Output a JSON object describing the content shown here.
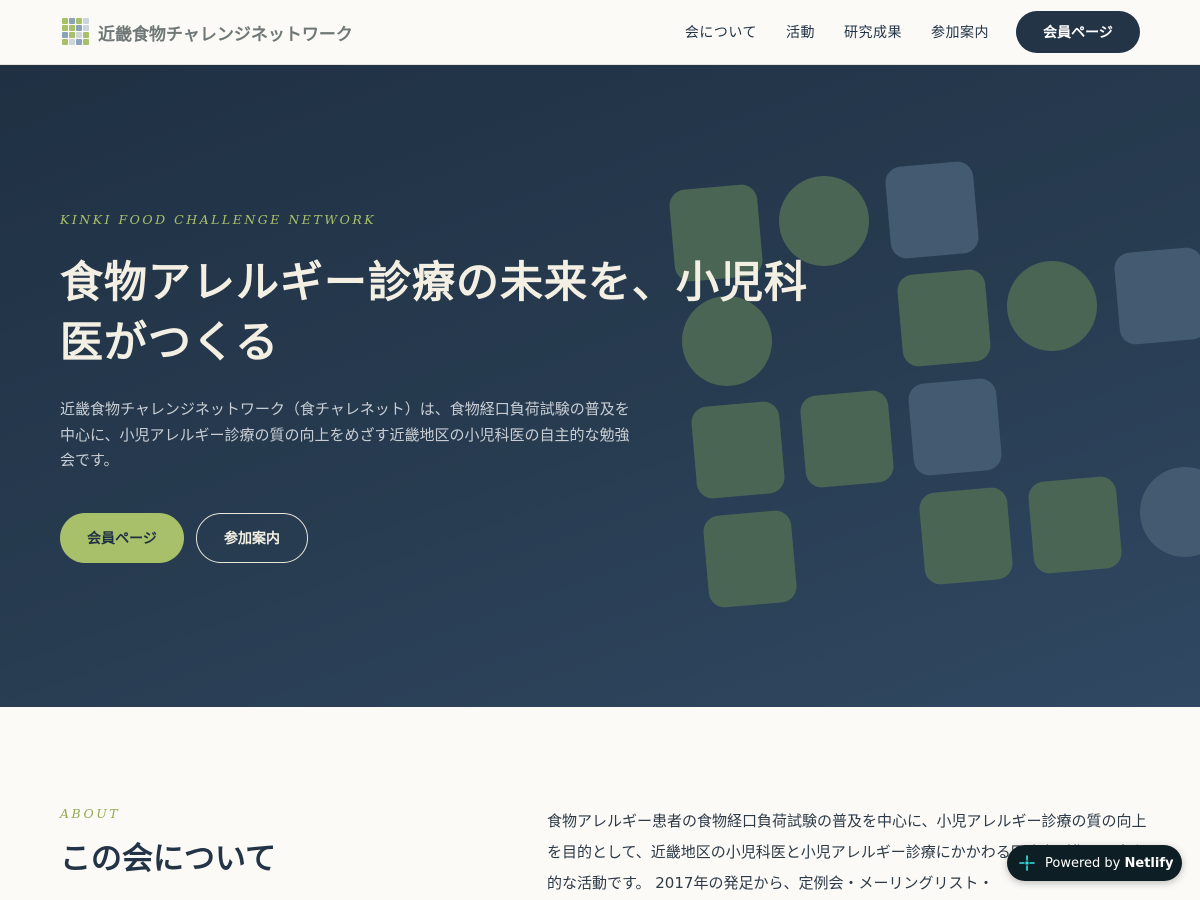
{
  "header": {
    "logo_text": "近畿食物チャレンジネットワーク",
    "nav": [
      {
        "label": "会について"
      },
      {
        "label": "活動"
      },
      {
        "label": "研究成果"
      },
      {
        "label": "参加案内"
      }
    ],
    "member_button": "会員ページ"
  },
  "hero": {
    "eyebrow": "KINKI FOOD CHALLENGE NETWORK",
    "title": "食物アレルギー診療の未来を、小児科医がつくる",
    "description": "近畿食物チャレンジネットワーク（食チャレネット）は、食物経口負荷試験の普及を中心に、小児アレルギー診療の質の向上をめざす近畿地区の小児科医の自主的な勉強会です。",
    "primary_button": "会員ページ",
    "secondary_button": "参加案内"
  },
  "about": {
    "label": "ABOUT",
    "title": "この会について",
    "text": "食物アレルギー患者の食物経口負荷試験の普及を中心に、小児アレルギー診療の質の向上を目的として、近畿地区の小児科医と小児アレルギー診療にかかわる医療者が集まる自主的な活動です。 2017年の発足から、定例会・メーリングリスト・"
  },
  "badge": {
    "prefix": "Powered by",
    "brand": "Netlify",
    "icon": "netlify-icon"
  },
  "colors": {
    "navy": "#233447",
    "accent_green": "#a9c06a",
    "cream": "#fbfaf6",
    "deco_green": "#4b6555",
    "deco_blue": "#435a71"
  }
}
